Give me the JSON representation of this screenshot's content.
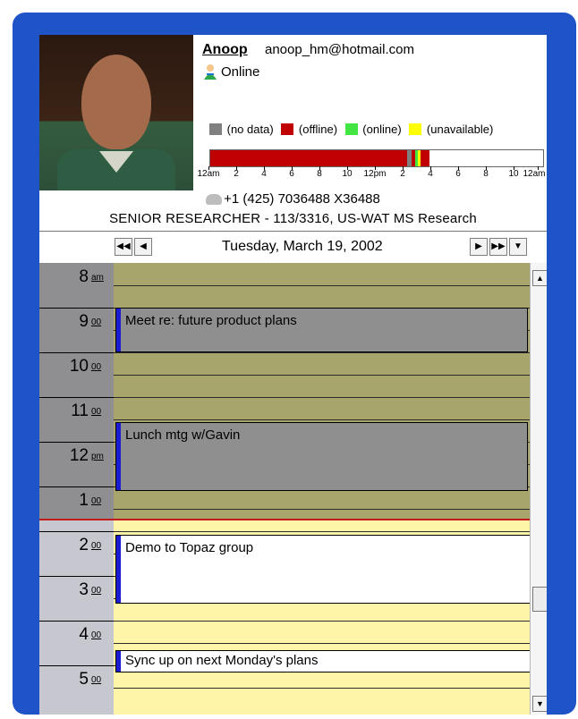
{
  "header": {
    "name": "Anoop",
    "email": "anoop_hm@hotmail.com",
    "status": "Online",
    "icons": {
      "status": "person-online-icon",
      "phone": "phone-icon",
      "prev_week": "double-left-arrow-icon",
      "prev_day": "left-arrow-icon",
      "next_day": "right-arrow-icon",
      "next_week": "double-right-arrow-icon",
      "menu": "dropdown-arrow-icon"
    }
  },
  "legend": {
    "items": [
      {
        "label": "(no data)",
        "color": "#808080"
      },
      {
        "label": "(offline)",
        "color": "#c00000"
      },
      {
        "label": "(online)",
        "color": "#43e543"
      },
      {
        "label": "(unavailable)",
        "color": "#ffff00"
      }
    ]
  },
  "timeline": {
    "ticks": [
      "12am",
      "2",
      "4",
      "6",
      "8",
      "10",
      "12pm",
      "2",
      "4",
      "6",
      "8",
      "10",
      "12am"
    ]
  },
  "contact": {
    "phone": "+1 (425) 7036488 X36488",
    "title_line": "SENIOR RESEARCHER - 113/3316, US-WAT MS Research"
  },
  "date": {
    "text": "Tuesday, March 19, 2002"
  },
  "times": [
    {
      "hour": "8",
      "suffix": "am"
    },
    {
      "hour": "9",
      "suffix": "00"
    },
    {
      "hour": "10",
      "suffix": "00"
    },
    {
      "hour": "11",
      "suffix": "00"
    },
    {
      "hour": "12",
      "suffix": "pm"
    },
    {
      "hour": "1",
      "suffix": "00"
    },
    {
      "hour": "2",
      "suffix": "00"
    },
    {
      "hour": "3",
      "suffix": "00"
    },
    {
      "hour": "4",
      "suffix": "00"
    },
    {
      "hour": "5",
      "suffix": "00"
    }
  ],
  "events": [
    {
      "title": "Meet re: future product plans"
    },
    {
      "title": "Lunch mtg w/Gavin"
    },
    {
      "title": "Demo to Topaz group"
    },
    {
      "title": "Sync up on next Monday's plans"
    }
  ],
  "colors": {
    "frame": "#1f53c8",
    "offline": "#c00000",
    "online": "#43e543",
    "unavailable": "#ffff00",
    "busy_grid": "#a7a56b",
    "free_grid": "#fff5a9",
    "event_marker": "#1b1bd1"
  }
}
